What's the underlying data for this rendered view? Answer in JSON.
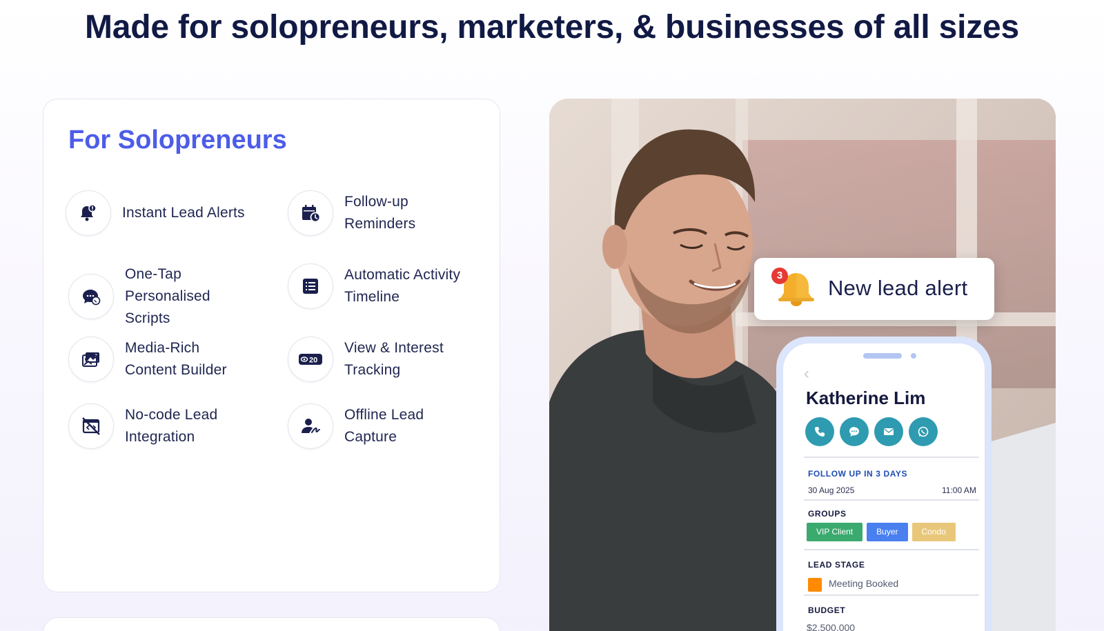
{
  "headline": "Made for solopreneurs, marketers, & businesses of all sizes",
  "card": {
    "title": "For Solopreneurs",
    "features": [
      {
        "label": "Instant Lead Alerts",
        "icon": "bell-alert-icon"
      },
      {
        "label": "Follow-up\nReminders",
        "icon": "calendar-clock-icon"
      },
      {
        "label": "One-Tap\nPersonalised\nScripts",
        "icon": "chat-whatsapp-icon"
      },
      {
        "label": "Automatic Activity\nTimeline",
        "icon": "list-timeline-icon"
      },
      {
        "label": "Media-Rich\nContent Builder",
        "icon": "media-gallery-icon"
      },
      {
        "label": "View & Interest\nTracking",
        "icon": "view-count-icon"
      },
      {
        "label": "No-code Lead\nIntegration",
        "icon": "no-code-icon"
      },
      {
        "label": "Offline Lead\nCapture",
        "icon": "user-signature-icon"
      }
    ],
    "view_badge": "20"
  },
  "alert": {
    "count": "3",
    "text": "New lead alert"
  },
  "phone": {
    "contact_name": "Katherine Lim",
    "actions": [
      "phone-icon",
      "chat-icon",
      "email-icon",
      "whatsapp-icon"
    ],
    "follow_up": {
      "heading": "FOLLOW UP IN 3 DAYS",
      "date": "30 Aug 2025",
      "time": "11:00 AM"
    },
    "groups": {
      "heading": "GROUPS",
      "chips": [
        {
          "label": "VIP Client",
          "color": "#3aaa6e"
        },
        {
          "label": "Buyer",
          "color": "#4a7ff0"
        },
        {
          "label": "Condo",
          "color": "#e8c77a"
        }
      ]
    },
    "lead_stage": {
      "heading": "LEAD STAGE",
      "value": "Meeting Booked",
      "color": "#ff8a00"
    },
    "budget": {
      "heading": "BUDGET",
      "value": "$2,500,000"
    }
  },
  "colors": {
    "accent": "#4d5ce8",
    "icon_navy": "#1a1f4d",
    "action_teal": "#2e9bb0",
    "headline": "#111a44"
  }
}
